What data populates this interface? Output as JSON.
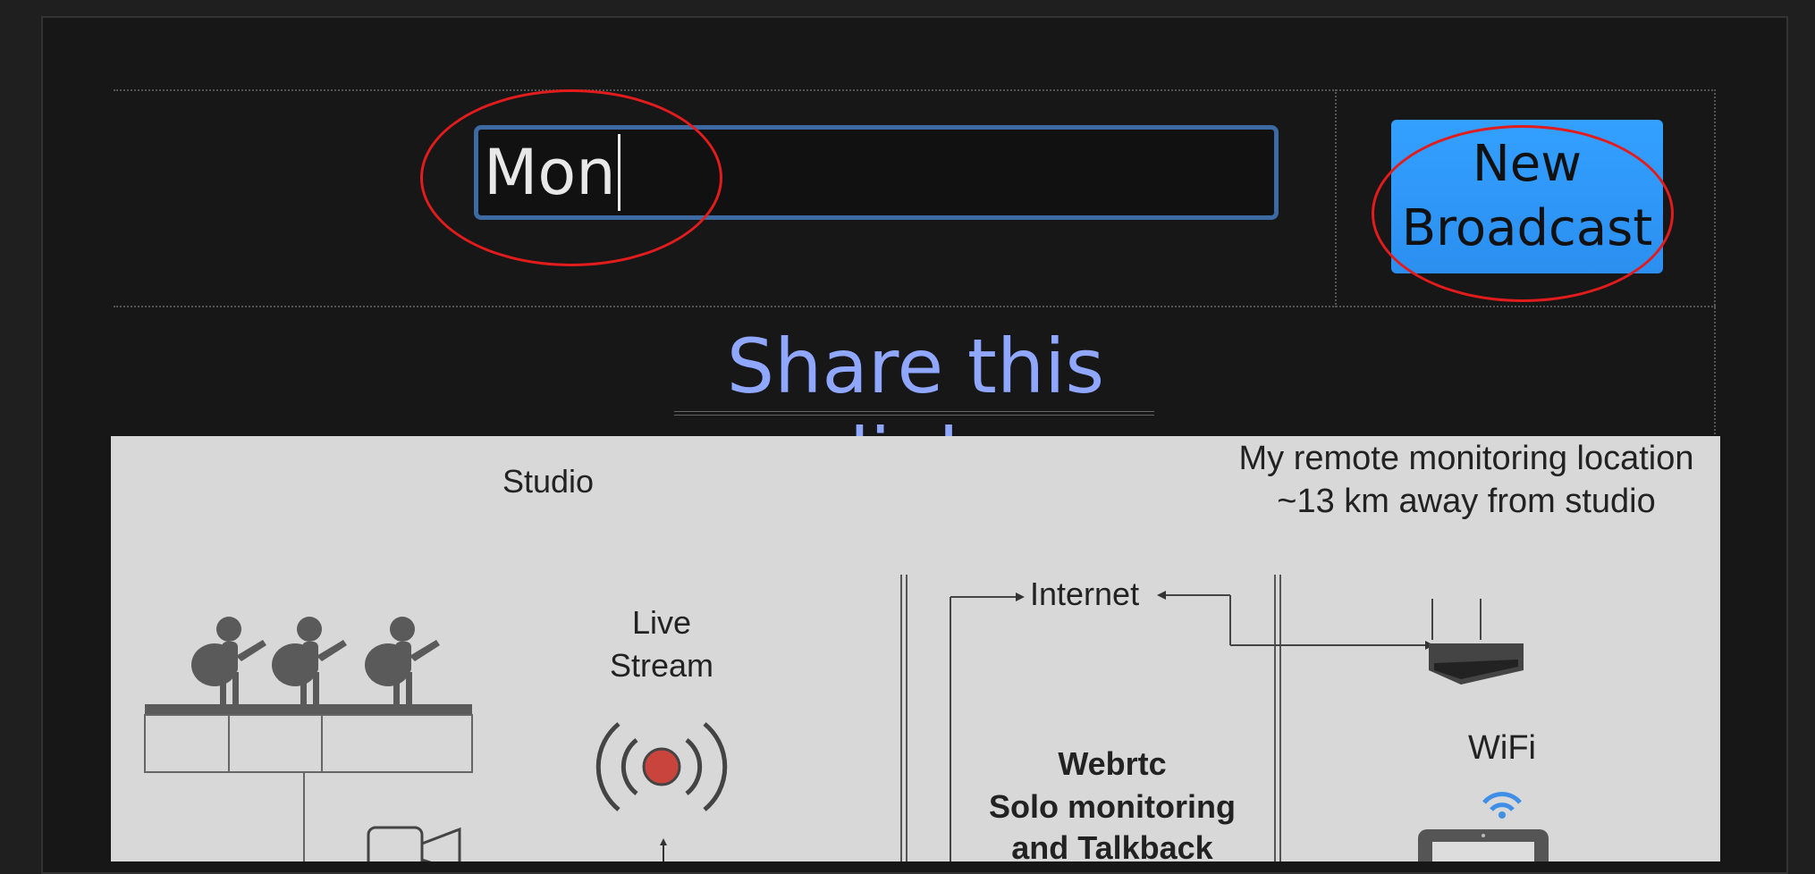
{
  "broadcast": {
    "title_value": "Mon",
    "new_button_line1": "New",
    "new_button_line2": "Broadcast"
  },
  "share": {
    "title": "Share this link"
  },
  "diagram": {
    "studio_label": "Studio",
    "remote_label_line1": "My remote monitoring location",
    "remote_label_line2": "~13 km away from studio",
    "internet_label": "Internet",
    "live_label_line1": "Live",
    "live_label_line2": "Stream",
    "wifi_label": "WiFi",
    "webrtc_line1": "Webrtc",
    "webrtc_line2": "Solo monitoring",
    "webrtc_line3": "and Talkback"
  },
  "colors": {
    "button": "#33a0ff",
    "input_border": "#3d6aa3",
    "share_title": "#8fa7ff",
    "annotation": "#e21c1c",
    "record_dot": "#c8443c",
    "wifi": "#3f8fe6"
  }
}
